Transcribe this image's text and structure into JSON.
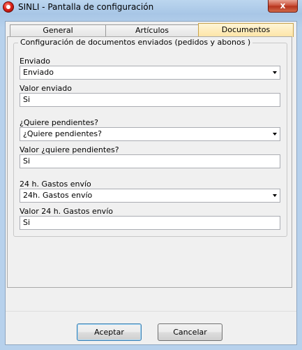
{
  "window": {
    "title": "SINLI - Pantalla de configuración",
    "close_glyph": "x"
  },
  "tabs": [
    {
      "label": "General"
    },
    {
      "label": "Artículos"
    },
    {
      "label": "Documentos"
    }
  ],
  "group": {
    "title": "Configuración de documentos enviados (pedidos y abonos )"
  },
  "fields": [
    {
      "select_label": "Enviado",
      "select_value": "Enviado",
      "value_label": "Valor enviado",
      "value": "Si"
    },
    {
      "select_label": "¿Quiere pendientes?",
      "select_value": "¿Quiere pendientes?",
      "value_label": "Valor ¿quiere pendientes?",
      "value": "Si"
    },
    {
      "select_label": "24 h. Gastos envío",
      "select_value": "24h. Gastos envío",
      "value_label": "Valor 24 h. Gastos envío",
      "value": "Si"
    }
  ],
  "buttons": {
    "accept": "Aceptar",
    "cancel": "Cancelar"
  }
}
